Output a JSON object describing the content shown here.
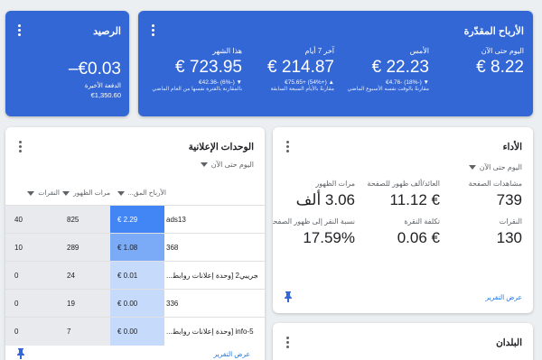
{
  "balance": {
    "title": "الرصيد",
    "value": "–€0.03",
    "last_payment_label": "الدفعة الأخيرة",
    "last_payment_value": "€1,350.60"
  },
  "estimated_earnings": {
    "title": "الأرباح المقدّرة",
    "stats": [
      {
        "label": "اليوم حتى الآن",
        "value": "€ 8.22",
        "change": "",
        "compare": ""
      },
      {
        "label": "الأمس",
        "value": "€ 22.23",
        "change": "▼ ‎€4.76- (18%-)",
        "compare": "مقارنةً بالوقت نفسه الأسبوع الماضي"
      },
      {
        "label": "آخر 7 أيام",
        "value": "€ 214.87",
        "change": "▲ ‎€75.65+ (54%+)",
        "compare": "مقارنةً بالأيام السبعة السابقة"
      },
      {
        "label": "هذا الشهر",
        "value": "€ 723.95",
        "change": "▼ ‎€42.36- (6%-)",
        "compare": "بالمقارنة بالفترة نفسها من العام الماضي"
      }
    ]
  },
  "performance": {
    "title": "الأداء",
    "range": "اليوم حتى الآن",
    "stats": [
      {
        "label": "مشاهدات الصفحة",
        "value": "739"
      },
      {
        "label": "العائد/ألف ظهور للصفحة",
        "value": "€ 11.12"
      },
      {
        "label": "مرات الظهور",
        "value": "3.06 ألف"
      },
      {
        "label": "النقرات",
        "value": "130"
      },
      {
        "label": "تكلفة النقرة",
        "value": "€ 0.06"
      },
      {
        "label": "نسبة النقر إلى ظهور الصفحة",
        "value": "17.59%"
      }
    ],
    "report_link": "عرض التقرير"
  },
  "ad_units": {
    "title": "الوحدات الإعلانية",
    "range": "اليوم حتى الآن",
    "columns": [
      "الأرباح المق...",
      "مرات الظهور",
      "النقرات"
    ],
    "rows": [
      {
        "name": "ads13",
        "earnings": "€ 2.29",
        "impressions": "825",
        "clicks": "40"
      },
      {
        "name": "368",
        "earnings": "€ 1.08",
        "impressions": "289",
        "clicks": "10"
      },
      {
        "name": "تجريبي2 [وحدة إعلانات روابط...",
        "earnings": "€ 0.01",
        "impressions": "24",
        "clicks": "0"
      },
      {
        "name": "336",
        "earnings": "€ 0.00",
        "impressions": "19",
        "clicks": "0"
      },
      {
        "name": "info-5 [وحدة إعلانات روابط...",
        "earnings": "€ 0.00",
        "impressions": "7",
        "clicks": "0"
      }
    ],
    "report_link": "عرض التقرير"
  },
  "countries": {
    "title": "البلدان"
  },
  "colors": {
    "brand_blue": "#3367d6",
    "earnings_col_dark": "#4285f4",
    "earnings_col_mid": "#7baaf7",
    "earnings_col_light": "#c6dafc"
  }
}
